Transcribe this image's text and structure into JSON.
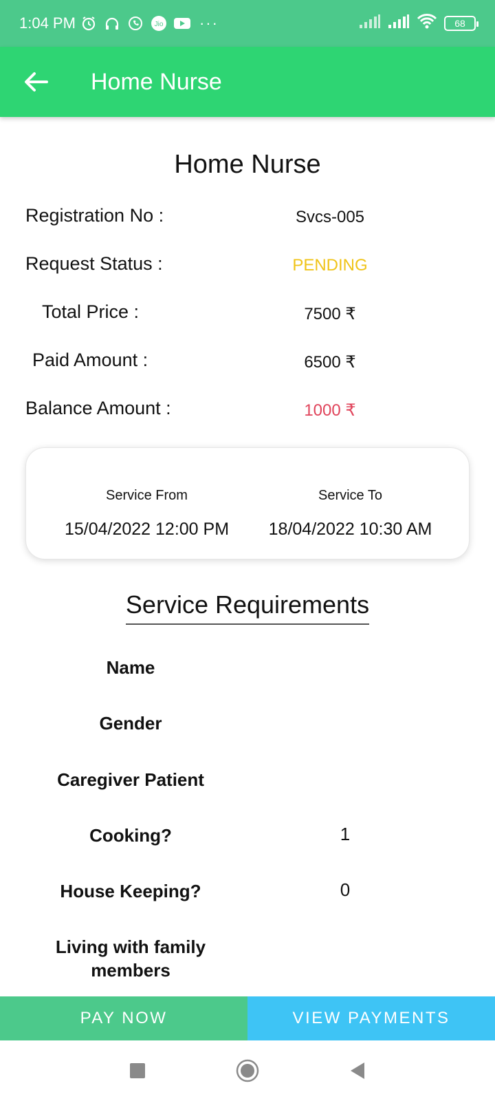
{
  "status_bar": {
    "time": "1:04 PM",
    "left_icons": [
      "alarm-icon",
      "headphones-icon",
      "whatsapp-icon",
      "jio-icon",
      "youtube-icon"
    ],
    "more": "···",
    "battery": "68"
  },
  "app_bar": {
    "title": "Home Nurse",
    "color": "#2ed573"
  },
  "page": {
    "title": "Home Nurse"
  },
  "info": {
    "registration_label": "Registration No :",
    "registration_value": "Svcs-005",
    "status_label": "Request Status :",
    "status_value": "PENDING",
    "status_color": "#f0c419",
    "total_label": "Total Price :",
    "total_value": "7500 ₹",
    "paid_label": "Paid Amount :",
    "paid_value": "6500 ₹",
    "balance_label": "Balance Amount :",
    "balance_value": "1000 ₹",
    "balance_color": "#e0435a"
  },
  "service_card": {
    "from_label": "Service From",
    "from_value": "15/04/2022 12:00 PM",
    "to_label": "Service To",
    "to_value": "18/04/2022 10:30 AM"
  },
  "requirements": {
    "title": "Service Requirements",
    "items": [
      {
        "label": "Name",
        "value": ""
      },
      {
        "label": "Gender",
        "value": ""
      },
      {
        "label": "Caregiver Patient",
        "value": ""
      },
      {
        "label": "Cooking?",
        "value": "1"
      },
      {
        "label": "House Keeping?",
        "value": "0"
      },
      {
        "label": "Living with family members",
        "value": ""
      }
    ]
  },
  "actions": {
    "pay_now": "PAY NOW",
    "view_payments": "VIEW PAYMENTS"
  },
  "nav": {
    "icons": [
      "recents-square-icon",
      "home-circle-icon",
      "back-triangle-icon"
    ]
  }
}
